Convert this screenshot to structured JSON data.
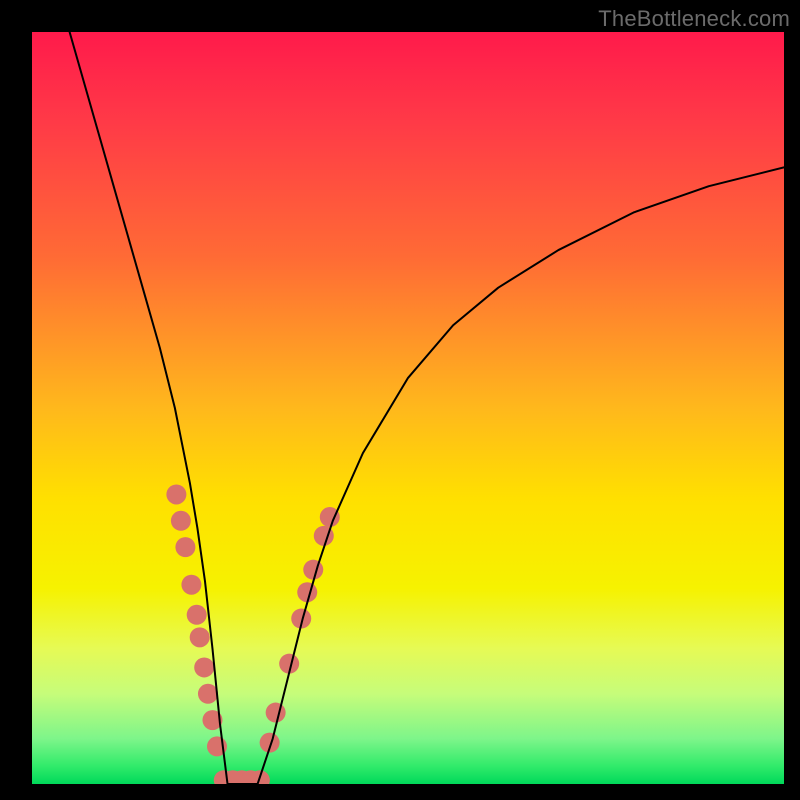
{
  "watermark": "TheBottleneck.com",
  "chart_data": {
    "type": "line",
    "title": "",
    "xlabel": "",
    "ylabel": "",
    "xlim": [
      0,
      100
    ],
    "ylim": [
      0,
      100
    ],
    "background": {
      "type": "vertical-gradient",
      "stops": [
        {
          "offset": 0.0,
          "color": "#ff1a4b"
        },
        {
          "offset": 0.12,
          "color": "#ff3a47"
        },
        {
          "offset": 0.3,
          "color": "#ff6b35"
        },
        {
          "offset": 0.5,
          "color": "#ffb81c"
        },
        {
          "offset": 0.62,
          "color": "#ffe000"
        },
        {
          "offset": 0.74,
          "color": "#f6f200"
        },
        {
          "offset": 0.82,
          "color": "#e6fa55"
        },
        {
          "offset": 0.88,
          "color": "#c6fc7a"
        },
        {
          "offset": 0.94,
          "color": "#7df58a"
        },
        {
          "offset": 0.975,
          "color": "#33eb6b"
        },
        {
          "offset": 1.0,
          "color": "#00d95a"
        }
      ]
    },
    "series": [
      {
        "name": "bottleneck-curve",
        "x": [
          5,
          7,
          9,
          11,
          13,
          15,
          17,
          19,
          20,
          21,
          22,
          23,
          24,
          25,
          26,
          27,
          28,
          30,
          32,
          34,
          36,
          38,
          40,
          44,
          50,
          56,
          62,
          70,
          80,
          90,
          100
        ],
        "y": [
          100,
          93,
          86,
          79,
          72,
          65,
          58,
          50,
          45,
          40,
          34,
          27,
          18,
          8,
          0,
          0,
          0,
          0,
          6,
          14,
          22,
          29,
          35,
          44,
          54,
          61,
          66,
          71,
          76,
          79.5,
          82
        ],
        "color": "#000000",
        "stroke_width": 2
      }
    ],
    "markers": [
      {
        "name": "left-segment-dots",
        "color": "#d9716b",
        "radius": 10,
        "points": [
          {
            "x": 19.2,
            "y": 38.5
          },
          {
            "x": 19.8,
            "y": 35.0
          },
          {
            "x": 20.4,
            "y": 31.5
          },
          {
            "x": 21.2,
            "y": 26.5
          },
          {
            "x": 21.9,
            "y": 22.5
          },
          {
            "x": 22.3,
            "y": 19.5
          },
          {
            "x": 22.9,
            "y": 15.5
          },
          {
            "x": 23.4,
            "y": 12.0
          },
          {
            "x": 24.0,
            "y": 8.5
          },
          {
            "x": 24.6,
            "y": 5.0
          }
        ]
      },
      {
        "name": "valley-flat-dots",
        "color": "#d9716b",
        "radius": 10,
        "points": [
          {
            "x": 25.5,
            "y": 0.5
          },
          {
            "x": 26.7,
            "y": 0.5
          },
          {
            "x": 27.9,
            "y": 0.5
          },
          {
            "x": 29.1,
            "y": 0.5
          },
          {
            "x": 30.3,
            "y": 0.5
          }
        ]
      },
      {
        "name": "right-segment-dots",
        "color": "#d9716b",
        "radius": 10,
        "points": [
          {
            "x": 31.6,
            "y": 5.5
          },
          {
            "x": 32.4,
            "y": 9.5
          },
          {
            "x": 34.2,
            "y": 16.0
          },
          {
            "x": 35.8,
            "y": 22.0
          },
          {
            "x": 36.6,
            "y": 25.5
          },
          {
            "x": 37.4,
            "y": 28.5
          },
          {
            "x": 38.8,
            "y": 33.0
          },
          {
            "x": 39.6,
            "y": 35.5
          }
        ]
      }
    ]
  }
}
